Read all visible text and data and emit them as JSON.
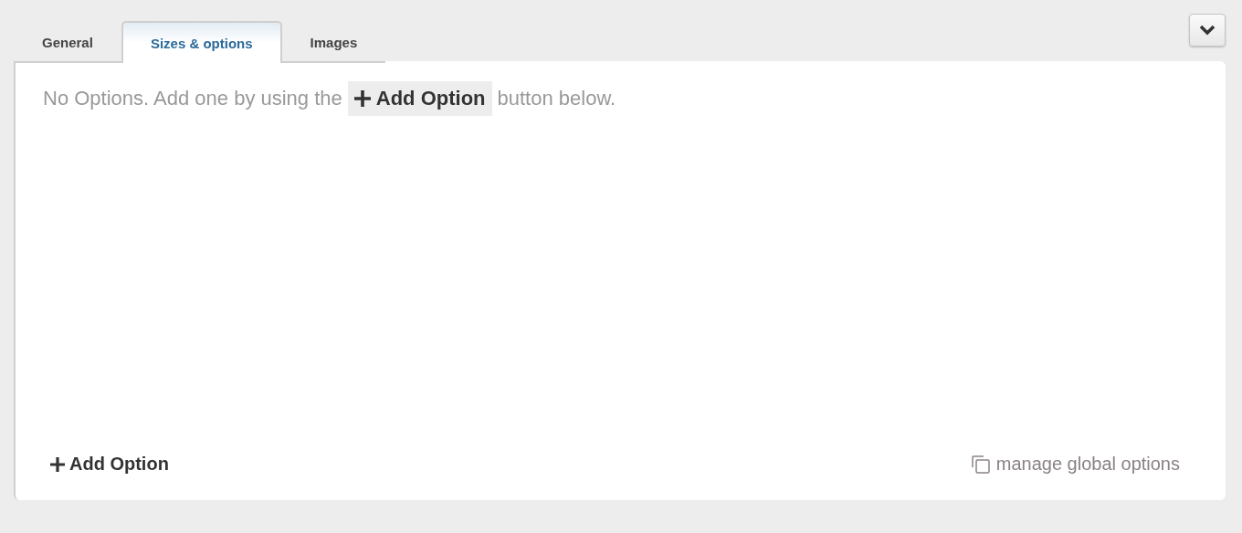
{
  "tabs": [
    {
      "label": "General",
      "selected": false
    },
    {
      "label": "Sizes & options",
      "selected": true
    },
    {
      "label": "Images",
      "selected": false
    }
  ],
  "empty_message": {
    "before": "No Options. Add one by using the",
    "chip": "Add Option",
    "after": "button below."
  },
  "footer": {
    "add_button": "Add Option",
    "global_link": "manage global options"
  }
}
